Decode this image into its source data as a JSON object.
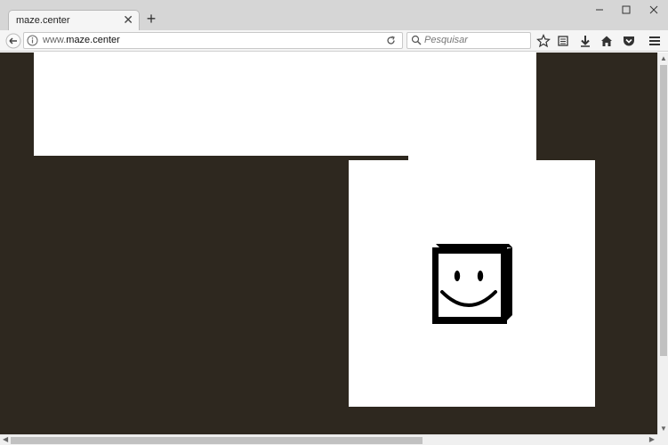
{
  "browser": {
    "tab_title": "maze.center",
    "tab_close_glyph": "✕",
    "new_tab_glyph": "+",
    "url_prefix": "www.",
    "url_domain": "maze.center",
    "search_placeholder": "Pesquisar",
    "icons": {
      "back": "back-arrow-icon",
      "info": "info-icon",
      "reload": "reload-icon",
      "search": "search-icon",
      "bookmark": "star-icon",
      "library": "library-icon",
      "download": "download-icon",
      "home": "home-icon",
      "pocket": "pocket-icon",
      "menu": "hamburger-menu-icon",
      "minimize": "minimize-icon",
      "maximize": "maximize-icon",
      "close": "close-icon"
    }
  },
  "page": {
    "background_color": "#2e281f",
    "wall_color": "#ffffff",
    "character": "smiley-cube-icon"
  },
  "scrollbars": {
    "up_glyph": "▲",
    "down_glyph": "▼",
    "left_glyph": "◀",
    "right_glyph": "▶"
  }
}
